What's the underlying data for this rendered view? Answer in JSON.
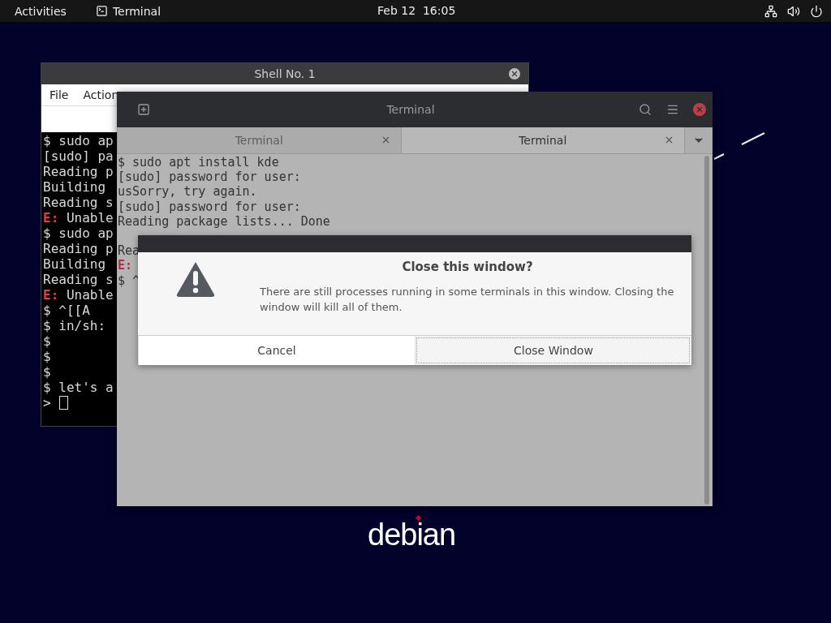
{
  "top_bar": {
    "activities": "Activities",
    "app": "Terminal",
    "clock": "Feb 12  16:05"
  },
  "shell_window": {
    "title": "Shell No. 1",
    "menu": [
      "File",
      "Action"
    ],
    "lines": [
      {
        "kind": "plain",
        "text": "$ sudo ap"
      },
      {
        "kind": "plain",
        "text": "[sudo] pa"
      },
      {
        "kind": "plain",
        "text": "Reading p"
      },
      {
        "kind": "plain",
        "text": "Building"
      },
      {
        "kind": "plain",
        "text": "Reading s"
      },
      {
        "kind": "error",
        "label": "E:",
        "text": " Unable"
      },
      {
        "kind": "plain",
        "text": "$ sudo ap"
      },
      {
        "kind": "plain",
        "text": "Reading p"
      },
      {
        "kind": "plain",
        "text": "Building"
      },
      {
        "kind": "plain",
        "text": "Reading s"
      },
      {
        "kind": "error",
        "label": "E:",
        "text": " Unable"
      },
      {
        "kind": "plain",
        "text": "$ ^[[A"
      },
      {
        "kind": "plain",
        "text": "$ in/sh:"
      },
      {
        "kind": "plain",
        "text": "$"
      },
      {
        "kind": "plain",
        "text": "$"
      },
      {
        "kind": "plain",
        "text": "$"
      },
      {
        "kind": "plain",
        "text": "$ let's a"
      },
      {
        "kind": "prompt",
        "text": ">"
      }
    ]
  },
  "terminal_window": {
    "title": "Terminal",
    "tabs": [
      {
        "label": "Terminal",
        "selected": false
      },
      {
        "label": "Terminal",
        "selected": true
      }
    ],
    "lines": [
      {
        "kind": "plain",
        "text": "$ sudo apt install kde"
      },
      {
        "kind": "plain",
        "text": "[sudo] password for user:"
      },
      {
        "kind": "plain",
        "text": "usSorry, try again."
      },
      {
        "kind": "plain",
        "text": "[sudo] password for user:"
      },
      {
        "kind": "plain",
        "text": "Reading package lists... Done"
      },
      {
        "kind": "blank"
      },
      {
        "kind": "plain",
        "text": "Rea"
      },
      {
        "kind": "error",
        "label": "E:"
      },
      {
        "kind": "plain",
        "text": "$ ^"
      }
    ]
  },
  "dialog": {
    "title": "Close this window?",
    "message": "There are still processes running in some terminals in this window. Closing the window will kill all of them.",
    "buttons": [
      {
        "label": "Cancel",
        "focused": false
      },
      {
        "label": "Close Window",
        "focused": true
      }
    ]
  },
  "desktop": {
    "logo": "debian"
  }
}
